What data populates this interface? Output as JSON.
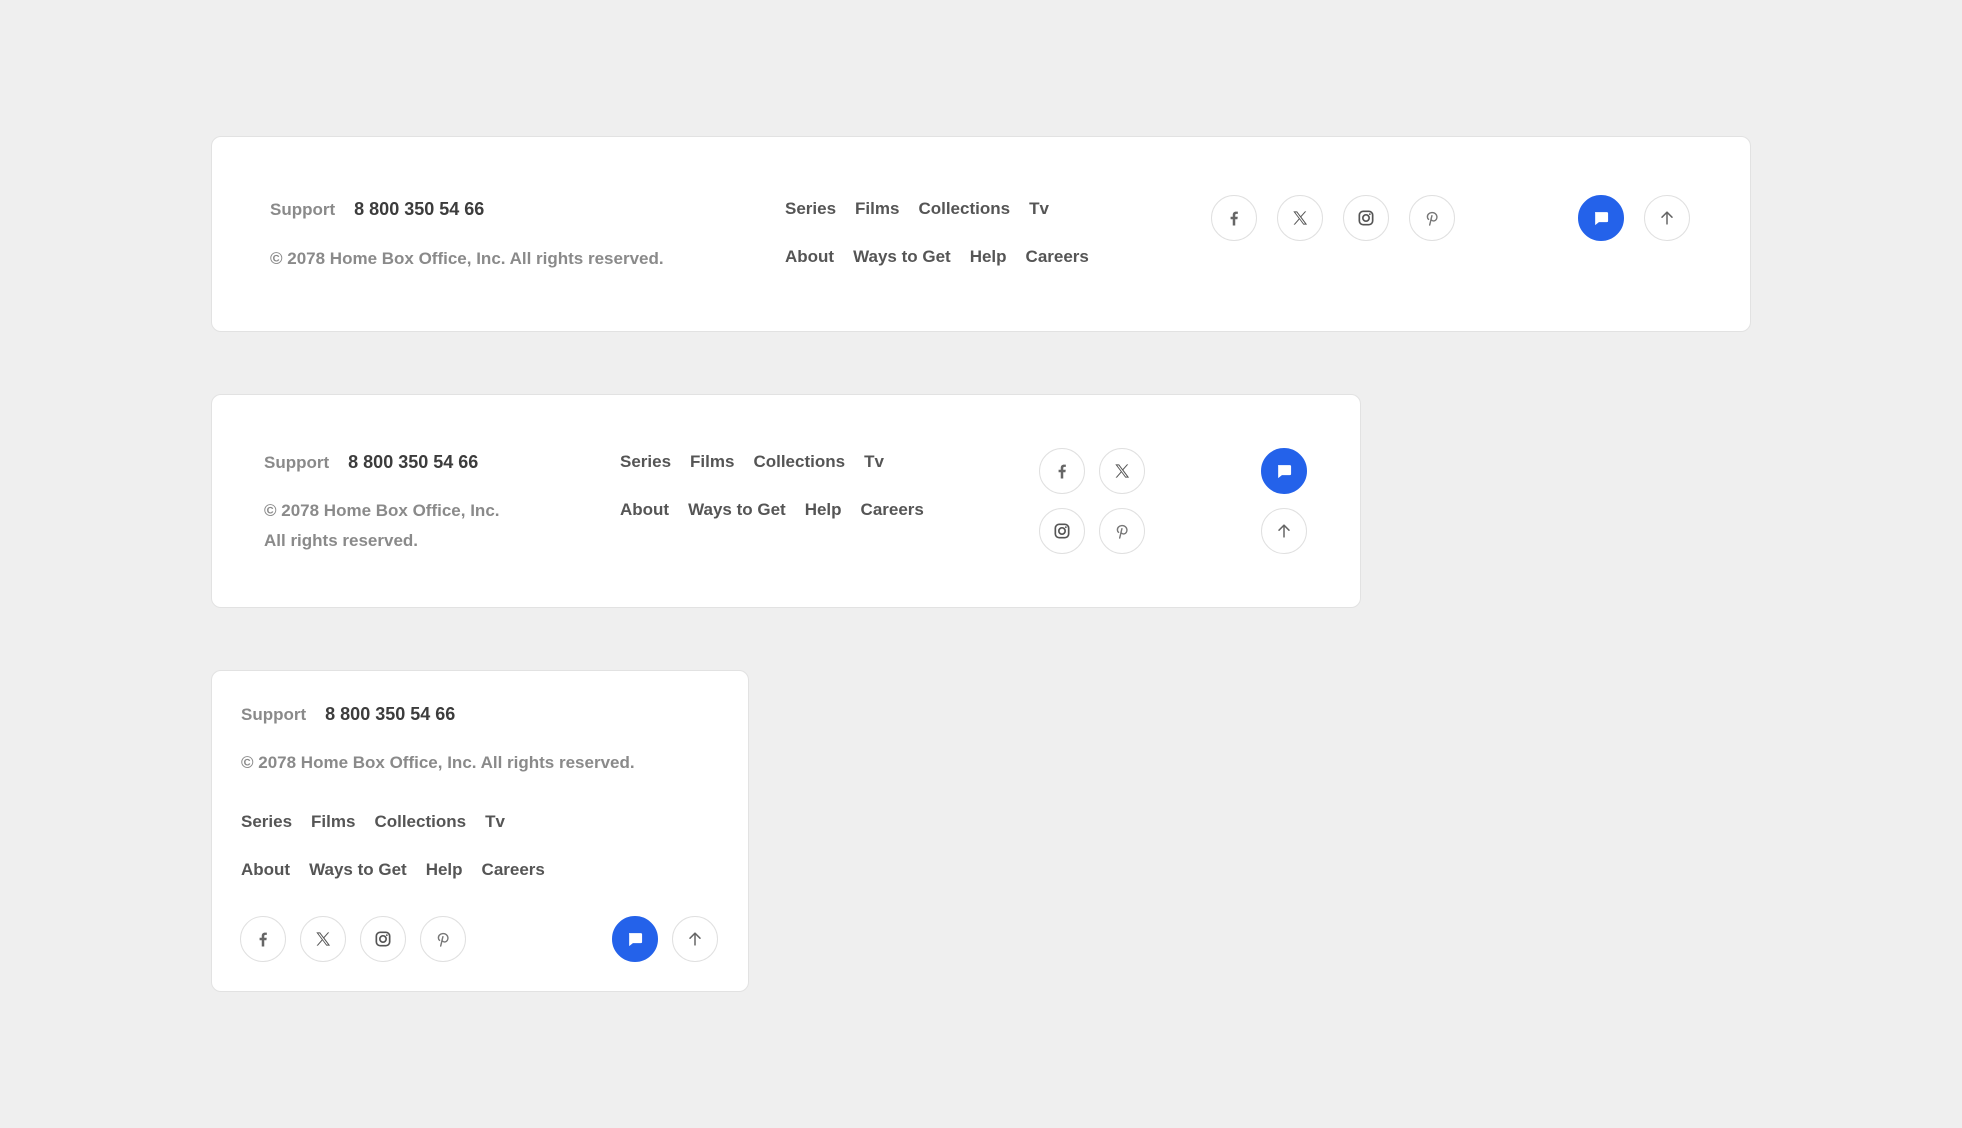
{
  "footer": {
    "support_label": "Support",
    "phone": "8 800 350 54 66",
    "copyright_full": "© 2078 Home Box Office, Inc. All rights reserved.",
    "copyright_line1": "© 2078 Home Box Office, Inc.",
    "copyright_line2": "All rights reserved.",
    "nav_primary": [
      "Series",
      "Films",
      "Collections",
      "Tv"
    ],
    "nav_secondary": [
      "About",
      "Ways to Get",
      "Help",
      "Careers"
    ],
    "social_icons": [
      "facebook-icon",
      "x-icon",
      "instagram-icon",
      "pinterest-icon"
    ],
    "chat_icon": "chat-icon",
    "scroll_top_icon": "arrow-up-icon",
    "colors": {
      "background": "#efefef",
      "card": "#ffffff",
      "accent": "#2462ea",
      "muted_text": "#8a8a8a",
      "link_text": "#555555",
      "phone_text": "#3c3c3c"
    }
  }
}
